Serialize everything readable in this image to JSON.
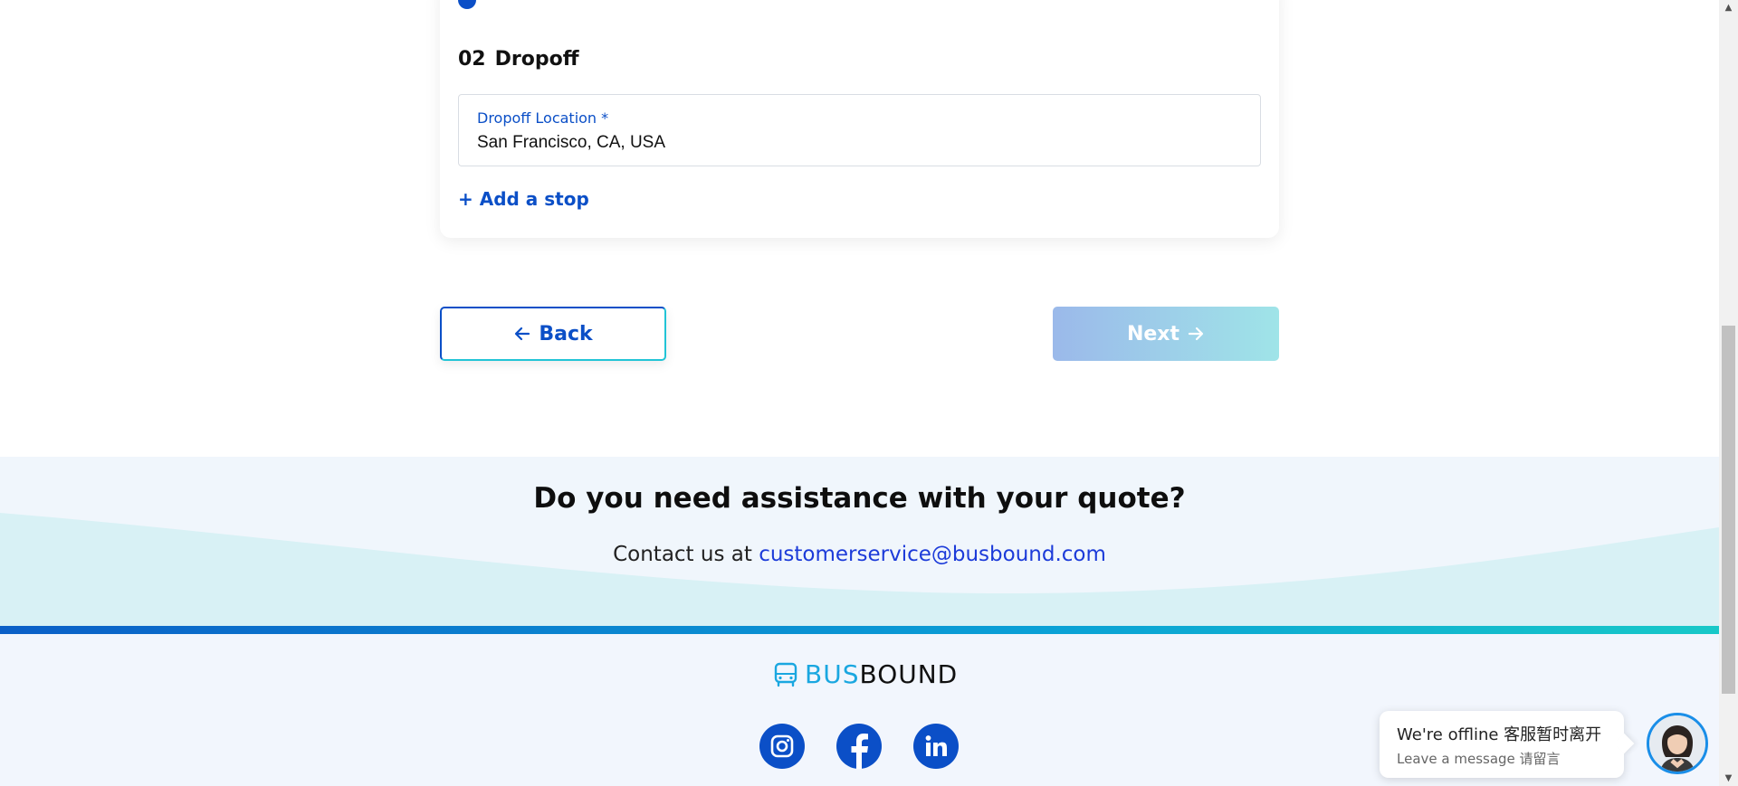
{
  "dropoff": {
    "step_number": "02",
    "title": "Dropoff",
    "field_label": "Dropoff Location *",
    "field_value": "San Francisco, CA, USA",
    "add_stop_label": "+ Add a stop"
  },
  "navigation": {
    "back_label": "Back",
    "next_label": "Next"
  },
  "assistance": {
    "heading": "Do you need assistance with your quote?",
    "contact_prefix": "Contact us at",
    "email": "customerservice@busbound.com"
  },
  "footer": {
    "logo_bus": "BUS",
    "logo_bound": "BOUND",
    "socials": [
      "instagram-icon",
      "facebook-icon",
      "linkedin-icon"
    ]
  },
  "chat": {
    "status": "We're offline 客服暂时离开",
    "prompt": "Leave a message 请留言"
  },
  "colors": {
    "brand_blue": "#0b4fc7",
    "teal": "#22c4d6",
    "link": "#1c3bd9"
  }
}
